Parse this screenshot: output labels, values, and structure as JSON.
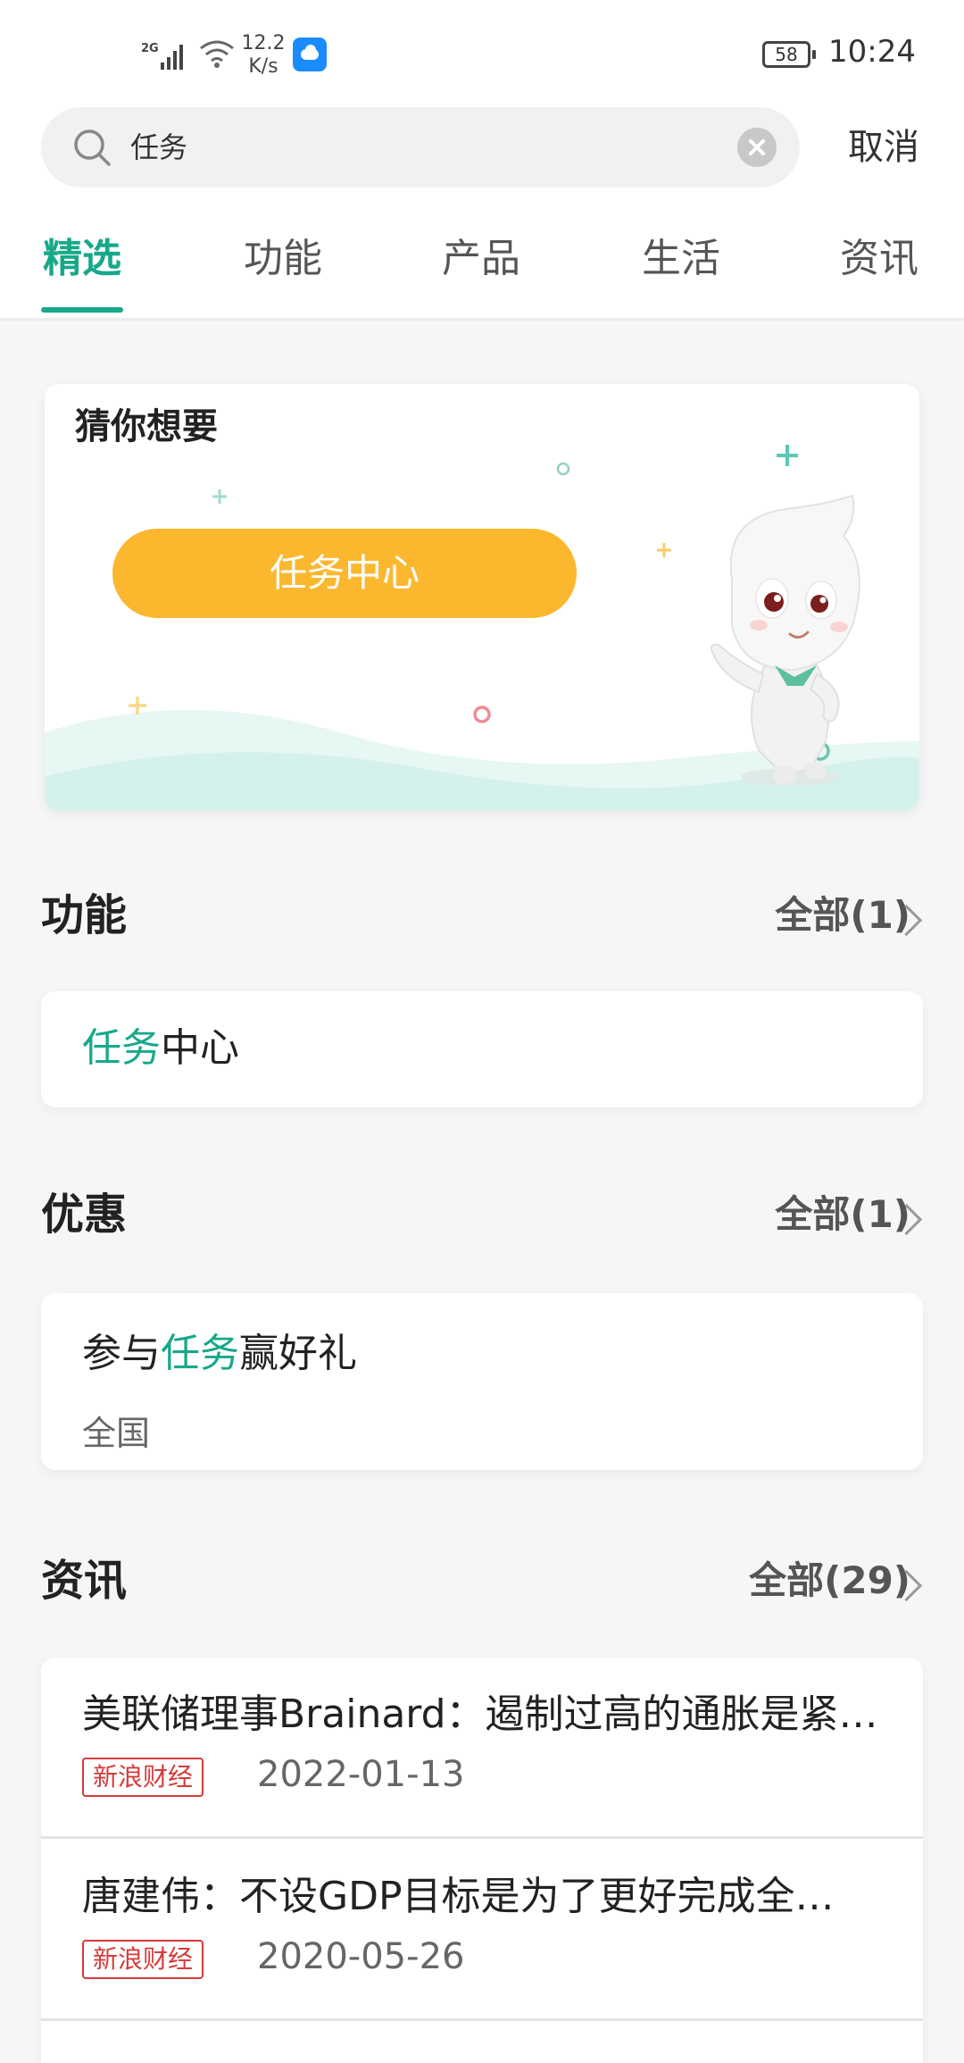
{
  "status_bar": {
    "network": "2G",
    "speed_value": "12.2",
    "speed_unit": "K/s",
    "battery": "58",
    "time": "10:24"
  },
  "search": {
    "query": "任务",
    "cancel_label": "取消"
  },
  "tabs": [
    {
      "label": "精选",
      "active": true
    },
    {
      "label": "功能",
      "active": false
    },
    {
      "label": "产品",
      "active": false
    },
    {
      "label": "生活",
      "active": false
    },
    {
      "label": "资讯",
      "active": false
    }
  ],
  "guess": {
    "title": "猜你想要",
    "button_label": "任务中心"
  },
  "features": {
    "title": "功能",
    "more": "全部(1)",
    "item": {
      "highlight": "任务",
      "rest": "中心"
    }
  },
  "offers": {
    "title": "优惠",
    "more": "全部(1)",
    "item": {
      "prefix": "参与",
      "highlight": "任务",
      "suffix": "赢好礼",
      "region": "全国"
    }
  },
  "news": {
    "title": "资讯",
    "more": "全部(29)",
    "items": [
      {
        "title": "美联储理事Brainard：遏制过高的通胀是紧…",
        "source": "新浪财经",
        "date": "2022-01-13"
      },
      {
        "title": "唐建伟：不设GDP目标是为了更好完成全…",
        "source": "新浪财经",
        "date": "2020-05-26"
      }
    ]
  },
  "colors": {
    "accent": "#17a88a",
    "button": "#fbb82f",
    "badge": "#d63b3b"
  }
}
